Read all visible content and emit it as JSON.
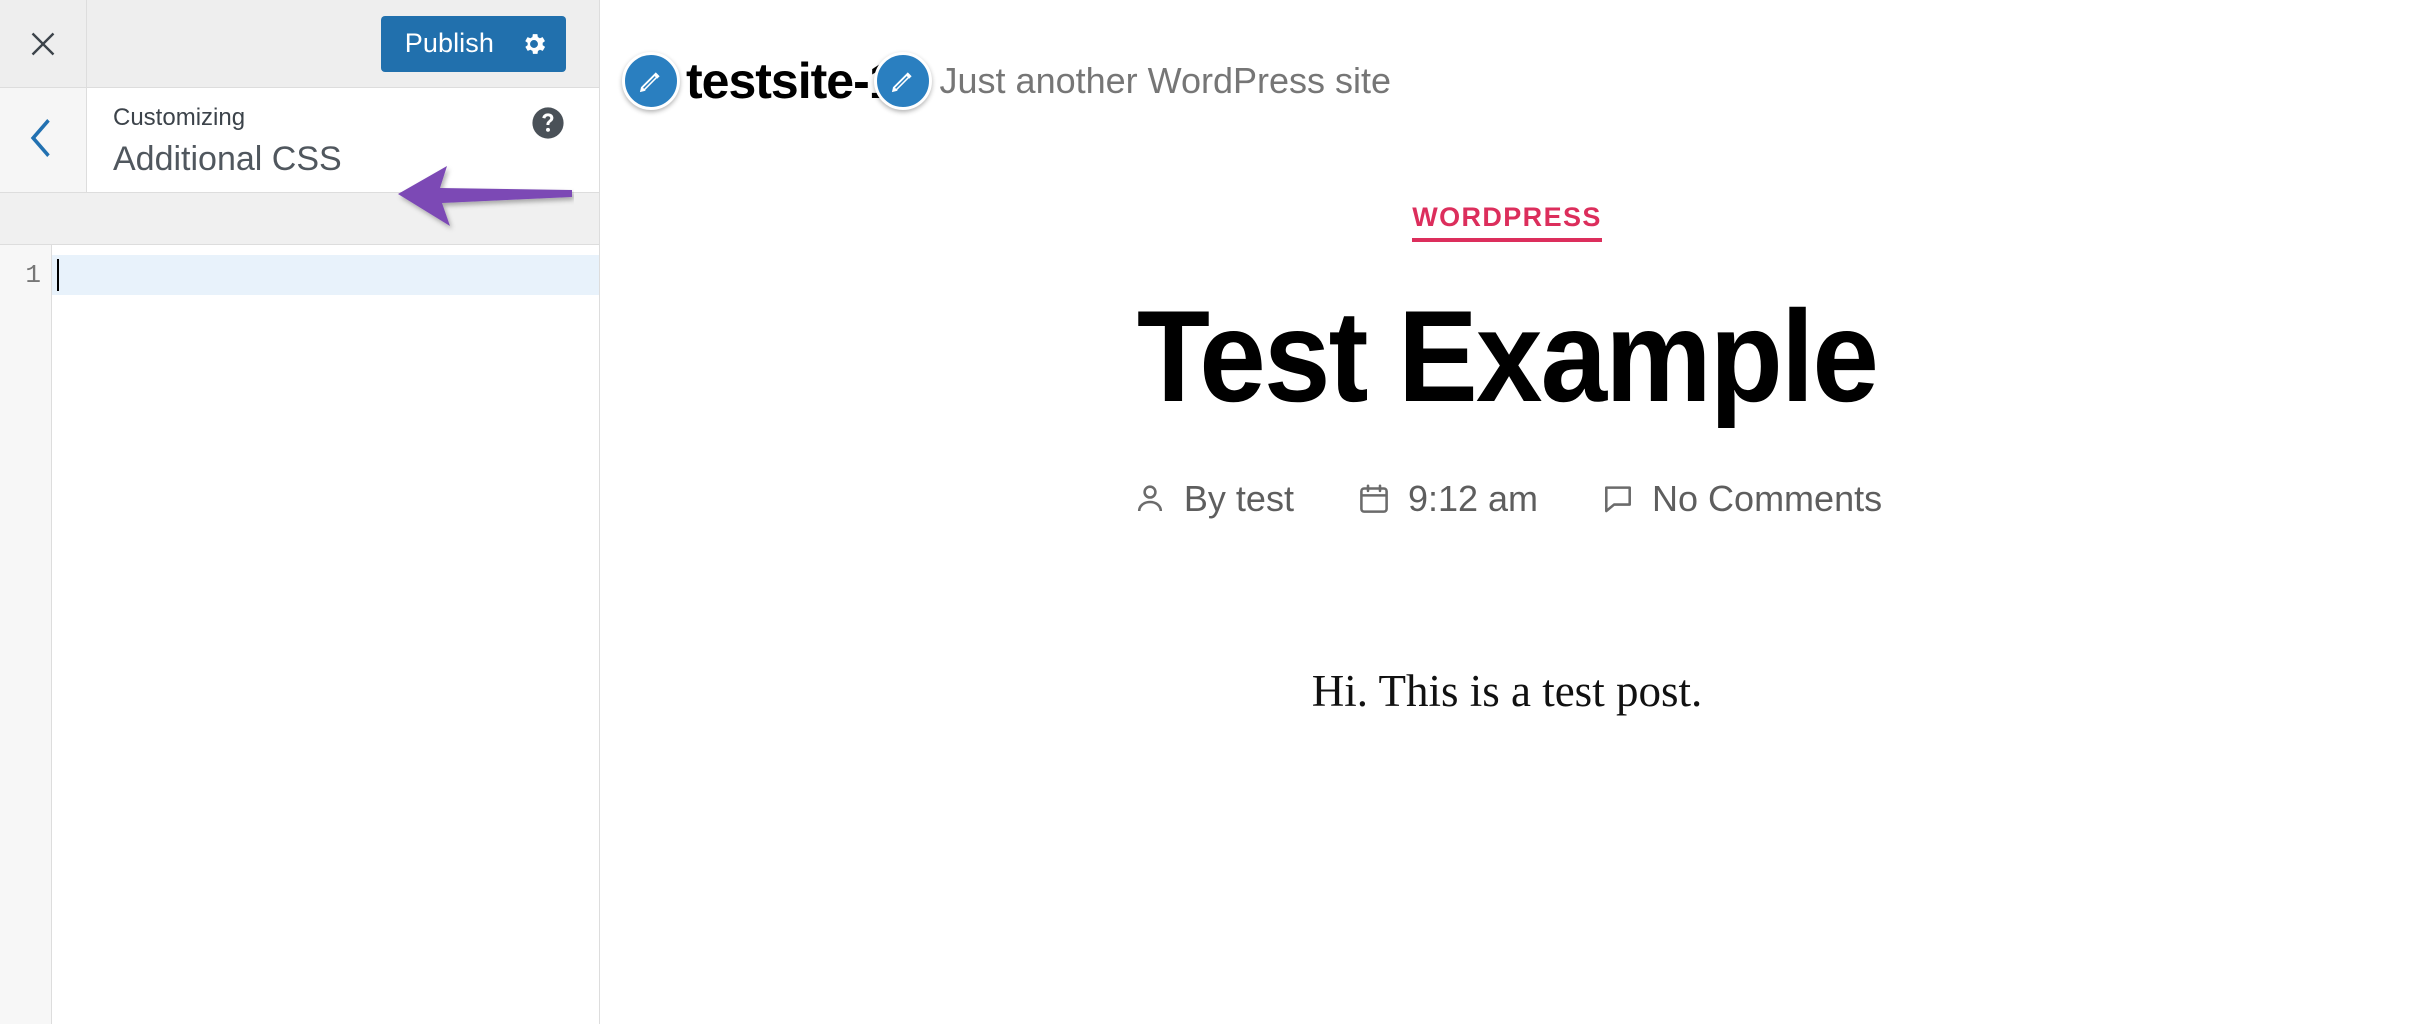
{
  "customizer": {
    "close_icon": "close-icon",
    "back_icon": "chevron-left-icon",
    "publish_label": "Publish",
    "gear_icon": "gear-icon",
    "help_icon": "help-icon",
    "eyebrow": "Customizing",
    "section_title": "Additional CSS",
    "accent_color": "#2170ad",
    "editor": {
      "line_numbers": [
        "1"
      ],
      "lines": [
        ""
      ],
      "active_line_color": "#e8f2fb",
      "caret_visible": true
    }
  },
  "annotation": {
    "type": "arrow",
    "direction": "left",
    "color": "#7b4ab5",
    "points_to": "Additional CSS"
  },
  "preview": {
    "site_title": "testsite-1",
    "site_tagline": "Just another WordPress site",
    "edit_shortcut_icon": "pencil-edit-icon",
    "post": {
      "category": "WORDPRESS",
      "category_color": "#dc2e5c",
      "title": "Test Example",
      "meta": [
        {
          "icon": "person-icon",
          "label": "By test"
        },
        {
          "icon": "calendar-icon",
          "label": "9:12 am"
        },
        {
          "icon": "comment-icon",
          "label": "No Comments"
        }
      ],
      "body": "Hi. This is a test post."
    }
  }
}
